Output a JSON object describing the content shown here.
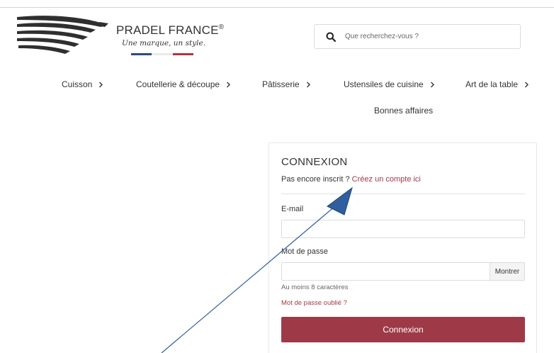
{
  "brand": {
    "name": "PRADEL FRANCE",
    "registered": "®",
    "tagline": "Une marque, un style.",
    "flag_colors": [
      "#2b4a8a",
      "#ffffff",
      "#b3333f"
    ],
    "wing_color": "#2f2f2f"
  },
  "search": {
    "placeholder": "Que recherchez-vous ?",
    "icon": "search-icon"
  },
  "nav": {
    "items": [
      {
        "label": "Cuisson"
      },
      {
        "label": "Coutellerie & découpe"
      },
      {
        "label": "Pâtisserie"
      },
      {
        "label": "Ustensiles de cuisine"
      },
      {
        "label": "Art de la table"
      }
    ],
    "extra": {
      "label": "Bonnes affaires"
    }
  },
  "login": {
    "title": "CONNEXION",
    "signup_prompt": "Pas encore inscrit ?",
    "signup_link": "Créez un compte ici",
    "email_label": "E-mail",
    "email_value": "",
    "password_label": "Mot de passe",
    "password_value": "",
    "show_button": "Montrer",
    "password_hint": "Au moins 8 caractères",
    "forgot_link": "Mot de passe oublié ?",
    "submit": "Connexion"
  },
  "colors": {
    "accent": "#9e3a48",
    "link": "#a33a47",
    "annotation_arrow": "#2f5f9e"
  }
}
